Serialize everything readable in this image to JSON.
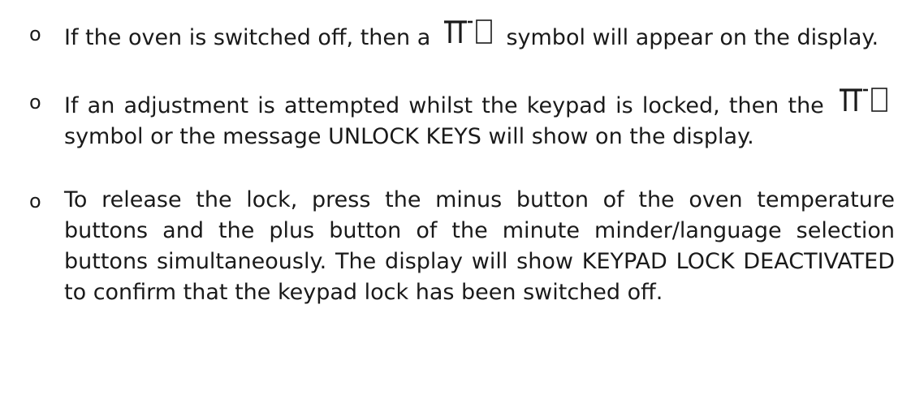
{
  "bullet_marker": "o",
  "lock_symbol_icon": "key-lock-symbol",
  "items": [
    {
      "before": "If the oven is switched off, then a",
      "after": "symbol will appear on the display."
    },
    {
      "before": "If an adjustment is attempted whilst the keypad is locked, then the",
      "after": "symbol or the message UNLOCK KEYS will show on the display."
    },
    {
      "text": "To release the lock, press the minus button of the oven temperature buttons and the plus button of the minute minder/language selection buttons simultaneously. The display will show KEYPAD LOCK DEACTIVATED to confirm that the keypad lock has been switched off."
    }
  ]
}
